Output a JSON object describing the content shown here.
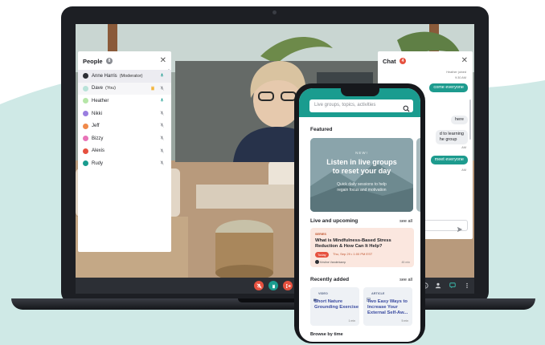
{
  "people_panel": {
    "title": "People",
    "count": "8",
    "members": [
      {
        "name": "Anne Harris",
        "suffix": "(Moderator)",
        "color": "#2c2f35"
      },
      {
        "name": "Dave",
        "suffix": "(You)",
        "color": "#b9e3d9"
      },
      {
        "name": "Heather",
        "suffix": "",
        "color": "#b6e6a8"
      },
      {
        "name": "Nikki",
        "suffix": "",
        "color": "#9a7ee0"
      },
      {
        "name": "Jeff",
        "suffix": "",
        "color": "#f08a4b"
      },
      {
        "name": "Bizzy",
        "suffix": "",
        "color": "#e874b8"
      },
      {
        "name": "Alexis",
        "suffix": "",
        "color": "#e6513f"
      },
      {
        "name": "Rudy",
        "suffix": "",
        "color": "#1a9c8f"
      }
    ]
  },
  "chat_panel": {
    "title": "Chat",
    "badge": "4",
    "meta_joined": "Heather joined",
    "meta_time": "9:30 AM",
    "msg_1": "come everyone",
    "msg_2": "here",
    "msg_3a": "d to learning",
    "msg_3b": "he group",
    "meta_time_2": "AM",
    "meta_time_3": "AM",
    "msg_4": "meet everyone"
  },
  "phone_app": {
    "search_placeholder": "Live groups, topics, activities",
    "featured_title": "Featured",
    "hero_eyebrow": "NEW!",
    "hero_title_1": "Listen in live groups",
    "hero_title_2": "to reset your day",
    "hero_sub_1": "Quick daily sessions to help",
    "hero_sub_2": "regain focus and motivation",
    "live_title": "Live and upcoming",
    "live_see_all": "see all",
    "event_category": "SERIES",
    "event_title_1": "What is Mindfulness-Based Stress",
    "event_title_2": "Reduction & How Can It Help?",
    "event_live": "Today",
    "event_date": "Thu, Sep 29 • 1:00 PM EST",
    "event_host": "Kristine Vanderkamp",
    "event_duration": "45 min",
    "recent_title": "Recently added",
    "recent_see_all": "see all",
    "card1_category": "VIDEO",
    "card1_title_1": "Short Nature",
    "card1_title_2": "Grounding Exercise",
    "card1_duration": "1 min",
    "card2_category": "ARTICLE",
    "card2_title_1": "Two Easy Ways to",
    "card2_title_2": "Increase Your",
    "card2_title_3": "External Self-Aw...",
    "card2_duration": "5 min",
    "browse_title": "Browse by time"
  },
  "colors": {
    "brand_teal": "#1a9c8f",
    "alert_red": "#e6513f",
    "event_bg": "#fbe7df"
  }
}
